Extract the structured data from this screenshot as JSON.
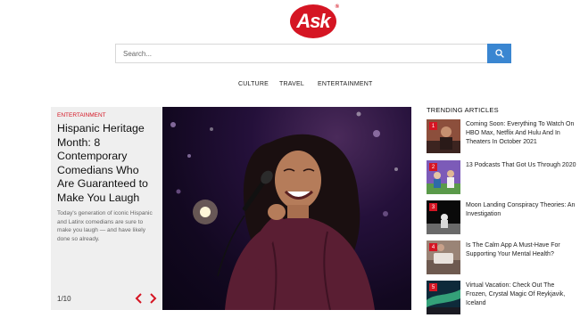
{
  "brand": {
    "logo_text": "Ask",
    "reg_mark": "®",
    "accent": "#d51523",
    "search_button_color": "#3a86d1"
  },
  "search": {
    "placeholder": "Search...",
    "value": "",
    "button_icon": "search-icon"
  },
  "nav": {
    "items": [
      "CULTURE",
      "TRAVEL",
      "ENTERTAINMENT"
    ]
  },
  "slideshow": {
    "category": "ENTERTAINMENT",
    "title": "Hispanic Heritage Month: 8 Contemporary Comedians Who Are Guaranteed to Make You Laugh",
    "description": "Today's generation of iconic Hispanic and Latinx comedians are sure to make you laugh — and have likely done so already.",
    "counter": "1/10",
    "prev_icon": "chevron-left-icon",
    "next_icon": "chevron-right-icon"
  },
  "trending": {
    "heading": "TRENDING ARTICLES",
    "items": [
      {
        "rank": "1",
        "title": "Coming Soon: Everything To Watch On HBO Max, Netflix And Hulu And In Theaters In October 2021"
      },
      {
        "rank": "2",
        "title": "13 Podcasts That Got Us Through 2020"
      },
      {
        "rank": "3",
        "title": "Moon Landing Conspiracy Theories: An Investigation"
      },
      {
        "rank": "4",
        "title": "Is The Calm App A Must-Have For Supporting Your Mental Health?"
      },
      {
        "rank": "5",
        "title": "Virtual Vacation: Check Out The Frozen, Crystal Magic Of Reykjavik, Iceland"
      }
    ]
  }
}
